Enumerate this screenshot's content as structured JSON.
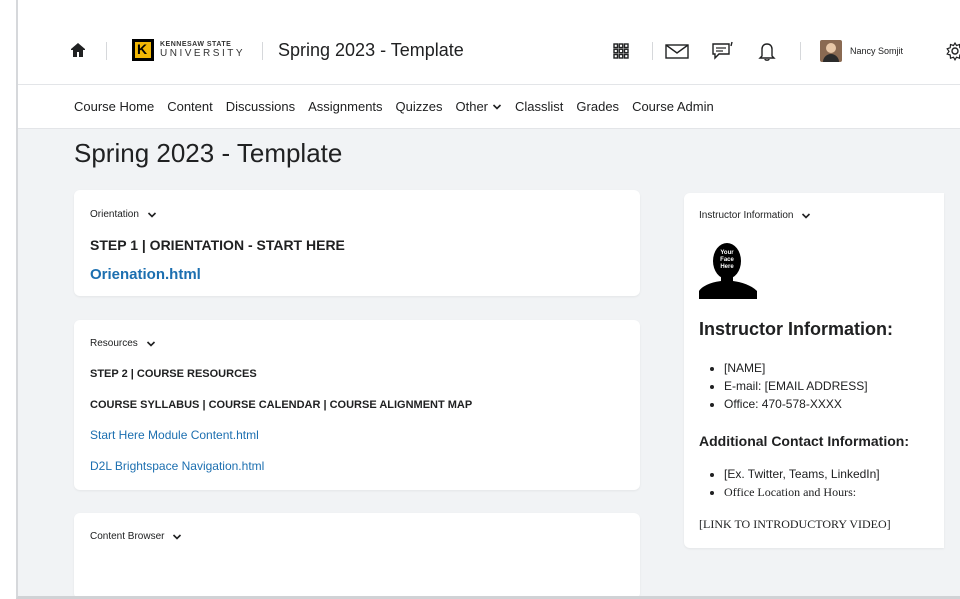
{
  "header": {
    "logo_line1": "KENNESAW STATE",
    "logo_line2": "UNIVERSITY",
    "course_title": "Spring 2023 - Template",
    "user_name": "Nancy Somjit",
    "icons": [
      "home-icon",
      "apps-grid-icon",
      "mail-icon",
      "chat-icon",
      "bell-icon",
      "gear-icon"
    ]
  },
  "nav": {
    "items": [
      "Course Home",
      "Content",
      "Discussions",
      "Assignments",
      "Quizzes",
      "Other",
      "Classlist",
      "Grades",
      "Course Admin"
    ]
  },
  "page": {
    "title": "Spring 2023 - Template"
  },
  "orientation": {
    "heading": "Orientation",
    "step": "STEP 1 | ORIENTATION - START HERE",
    "link": "Orienation.html"
  },
  "resources": {
    "heading": "Resources",
    "step": "STEP 2  |  COURSE RESOURCES",
    "subline": "COURSE SYLLABUS | COURSE CALENDAR | COURSE ALIGNMENT MAP",
    "links": [
      "Start Here Module Content.html",
      "D2L Brightspace Navigation.html"
    ]
  },
  "content_browser": {
    "heading": "Content Browser"
  },
  "instructor": {
    "heading": "Instructor Information",
    "placeholder_text": [
      "Your",
      "Face",
      "Here"
    ],
    "title": "Instructor Information:",
    "items": [
      "[NAME]",
      "E-mail: [EMAIL ADDRESS]",
      "Office: 470-578-XXXX"
    ],
    "additional_title": "Additional Contact Information:",
    "additional_items": [
      "[Ex. Twitter, Teams, LinkedIn]",
      "Office Location and Hours:"
    ],
    "video_link": "[LINK TO INTRODUCTORY VIDEO]"
  },
  "colors": {
    "link": "#1c6fb0",
    "background": "#f1f3f5"
  }
}
